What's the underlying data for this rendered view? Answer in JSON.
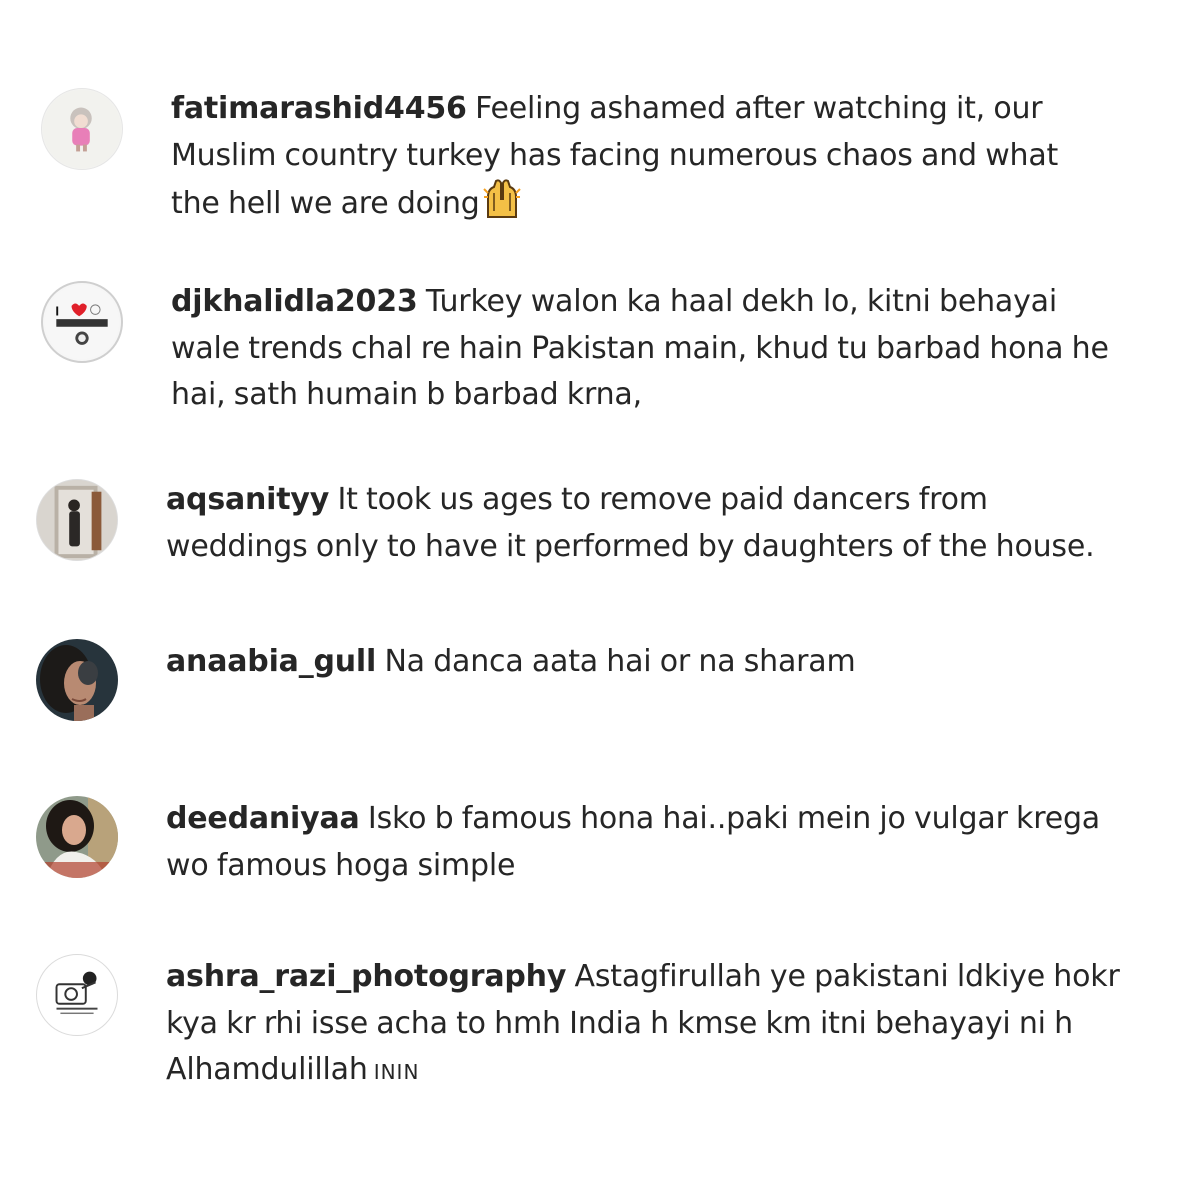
{
  "comments": [
    {
      "username": "fatimarashid4456",
      "lines": [
        "Feeling ashamed after watching it, our",
        "Muslim country turkey has facing numerous chaos and what",
        "the hell we are doing"
      ],
      "avatar_icon": "cartoon-girl-avatar",
      "trailing_emoji": "raising-hands-emoji"
    },
    {
      "username": "djkhalidla2023",
      "lines": [
        "Turkey walon ka haal dekh lo, kitni behayai",
        "wale trends chal re hain Pakistan main, khud tu barbad hona he",
        "hai, sath humain b barbad krna,"
      ],
      "avatar_icon": "i-love-logo-avatar",
      "avatar_text": "I"
    },
    {
      "username": "aqsanityy",
      "lines": [
        "It took us ages to remove paid dancers from",
        "weddings only to have it performed by daughters of the house."
      ],
      "avatar_icon": "mirror-selfie-avatar"
    },
    {
      "username": "anaabia_gull",
      "lines": [
        "Na danca aata hai or na sharam"
      ],
      "avatar_icon": "portrait-photo-avatar"
    },
    {
      "username": "deedaniyaa",
      "lines": [
        "Isko b famous hona hai..paki mein jo vulgar krega",
        "wo famous hoga simple"
      ],
      "avatar_icon": "portrait-photo-avatar"
    },
    {
      "username": "ashra_razi_photography",
      "lines": [
        "Astagfirullah ye pakistani ldkiye hokr",
        "kya kr rhi isse acha to hmh India h kmse km itni behayayi ni h",
        "Alhamdulillah"
      ],
      "trailing_text": "ININ",
      "avatar_icon": "photography-logo-avatar"
    }
  ],
  "colors": {
    "text": "#262626",
    "background": "#ffffff",
    "avatar_border": "#dbdbdb"
  }
}
